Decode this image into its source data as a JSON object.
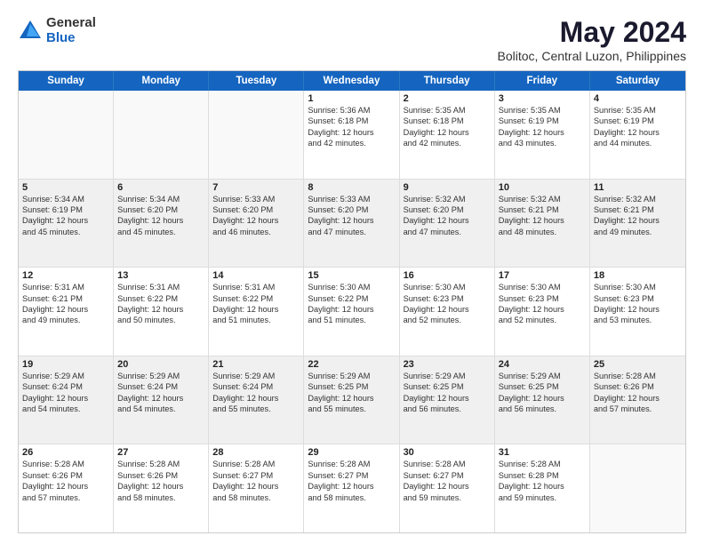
{
  "logo": {
    "general": "General",
    "blue": "Blue"
  },
  "title": "May 2024",
  "subtitle": "Bolitoc, Central Luzon, Philippines",
  "header_days": [
    "Sunday",
    "Monday",
    "Tuesday",
    "Wednesday",
    "Thursday",
    "Friday",
    "Saturday"
  ],
  "rows": [
    [
      {
        "day": "",
        "lines": [],
        "empty": true
      },
      {
        "day": "",
        "lines": [],
        "empty": true
      },
      {
        "day": "",
        "lines": [],
        "empty": true
      },
      {
        "day": "1",
        "lines": [
          "Sunrise: 5:36 AM",
          "Sunset: 6:18 PM",
          "Daylight: 12 hours",
          "and 42 minutes."
        ]
      },
      {
        "day": "2",
        "lines": [
          "Sunrise: 5:35 AM",
          "Sunset: 6:18 PM",
          "Daylight: 12 hours",
          "and 42 minutes."
        ]
      },
      {
        "day": "3",
        "lines": [
          "Sunrise: 5:35 AM",
          "Sunset: 6:19 PM",
          "Daylight: 12 hours",
          "and 43 minutes."
        ]
      },
      {
        "day": "4",
        "lines": [
          "Sunrise: 5:35 AM",
          "Sunset: 6:19 PM",
          "Daylight: 12 hours",
          "and 44 minutes."
        ]
      }
    ],
    [
      {
        "day": "5",
        "lines": [
          "Sunrise: 5:34 AM",
          "Sunset: 6:19 PM",
          "Daylight: 12 hours",
          "and 45 minutes."
        ],
        "shaded": true
      },
      {
        "day": "6",
        "lines": [
          "Sunrise: 5:34 AM",
          "Sunset: 6:20 PM",
          "Daylight: 12 hours",
          "and 45 minutes."
        ],
        "shaded": true
      },
      {
        "day": "7",
        "lines": [
          "Sunrise: 5:33 AM",
          "Sunset: 6:20 PM",
          "Daylight: 12 hours",
          "and 46 minutes."
        ],
        "shaded": true
      },
      {
        "day": "8",
        "lines": [
          "Sunrise: 5:33 AM",
          "Sunset: 6:20 PM",
          "Daylight: 12 hours",
          "and 47 minutes."
        ],
        "shaded": true
      },
      {
        "day": "9",
        "lines": [
          "Sunrise: 5:32 AM",
          "Sunset: 6:20 PM",
          "Daylight: 12 hours",
          "and 47 minutes."
        ],
        "shaded": true
      },
      {
        "day": "10",
        "lines": [
          "Sunrise: 5:32 AM",
          "Sunset: 6:21 PM",
          "Daylight: 12 hours",
          "and 48 minutes."
        ],
        "shaded": true
      },
      {
        "day": "11",
        "lines": [
          "Sunrise: 5:32 AM",
          "Sunset: 6:21 PM",
          "Daylight: 12 hours",
          "and 49 minutes."
        ],
        "shaded": true
      }
    ],
    [
      {
        "day": "12",
        "lines": [
          "Sunrise: 5:31 AM",
          "Sunset: 6:21 PM",
          "Daylight: 12 hours",
          "and 49 minutes."
        ]
      },
      {
        "day": "13",
        "lines": [
          "Sunrise: 5:31 AM",
          "Sunset: 6:22 PM",
          "Daylight: 12 hours",
          "and 50 minutes."
        ]
      },
      {
        "day": "14",
        "lines": [
          "Sunrise: 5:31 AM",
          "Sunset: 6:22 PM",
          "Daylight: 12 hours",
          "and 51 minutes."
        ]
      },
      {
        "day": "15",
        "lines": [
          "Sunrise: 5:30 AM",
          "Sunset: 6:22 PM",
          "Daylight: 12 hours",
          "and 51 minutes."
        ]
      },
      {
        "day": "16",
        "lines": [
          "Sunrise: 5:30 AM",
          "Sunset: 6:23 PM",
          "Daylight: 12 hours",
          "and 52 minutes."
        ]
      },
      {
        "day": "17",
        "lines": [
          "Sunrise: 5:30 AM",
          "Sunset: 6:23 PM",
          "Daylight: 12 hours",
          "and 52 minutes."
        ]
      },
      {
        "day": "18",
        "lines": [
          "Sunrise: 5:30 AM",
          "Sunset: 6:23 PM",
          "Daylight: 12 hours",
          "and 53 minutes."
        ]
      }
    ],
    [
      {
        "day": "19",
        "lines": [
          "Sunrise: 5:29 AM",
          "Sunset: 6:24 PM",
          "Daylight: 12 hours",
          "and 54 minutes."
        ],
        "shaded": true
      },
      {
        "day": "20",
        "lines": [
          "Sunrise: 5:29 AM",
          "Sunset: 6:24 PM",
          "Daylight: 12 hours",
          "and 54 minutes."
        ],
        "shaded": true
      },
      {
        "day": "21",
        "lines": [
          "Sunrise: 5:29 AM",
          "Sunset: 6:24 PM",
          "Daylight: 12 hours",
          "and 55 minutes."
        ],
        "shaded": true
      },
      {
        "day": "22",
        "lines": [
          "Sunrise: 5:29 AM",
          "Sunset: 6:25 PM",
          "Daylight: 12 hours",
          "and 55 minutes."
        ],
        "shaded": true
      },
      {
        "day": "23",
        "lines": [
          "Sunrise: 5:29 AM",
          "Sunset: 6:25 PM",
          "Daylight: 12 hours",
          "and 56 minutes."
        ],
        "shaded": true
      },
      {
        "day": "24",
        "lines": [
          "Sunrise: 5:29 AM",
          "Sunset: 6:25 PM",
          "Daylight: 12 hours",
          "and 56 minutes."
        ],
        "shaded": true
      },
      {
        "day": "25",
        "lines": [
          "Sunrise: 5:28 AM",
          "Sunset: 6:26 PM",
          "Daylight: 12 hours",
          "and 57 minutes."
        ],
        "shaded": true
      }
    ],
    [
      {
        "day": "26",
        "lines": [
          "Sunrise: 5:28 AM",
          "Sunset: 6:26 PM",
          "Daylight: 12 hours",
          "and 57 minutes."
        ]
      },
      {
        "day": "27",
        "lines": [
          "Sunrise: 5:28 AM",
          "Sunset: 6:26 PM",
          "Daylight: 12 hours",
          "and 58 minutes."
        ]
      },
      {
        "day": "28",
        "lines": [
          "Sunrise: 5:28 AM",
          "Sunset: 6:27 PM",
          "Daylight: 12 hours",
          "and 58 minutes."
        ]
      },
      {
        "day": "29",
        "lines": [
          "Sunrise: 5:28 AM",
          "Sunset: 6:27 PM",
          "Daylight: 12 hours",
          "and 58 minutes."
        ]
      },
      {
        "day": "30",
        "lines": [
          "Sunrise: 5:28 AM",
          "Sunset: 6:27 PM",
          "Daylight: 12 hours",
          "and 59 minutes."
        ]
      },
      {
        "day": "31",
        "lines": [
          "Sunrise: 5:28 AM",
          "Sunset: 6:28 PM",
          "Daylight: 12 hours",
          "and 59 minutes."
        ]
      },
      {
        "day": "",
        "lines": [],
        "empty": true
      }
    ]
  ]
}
